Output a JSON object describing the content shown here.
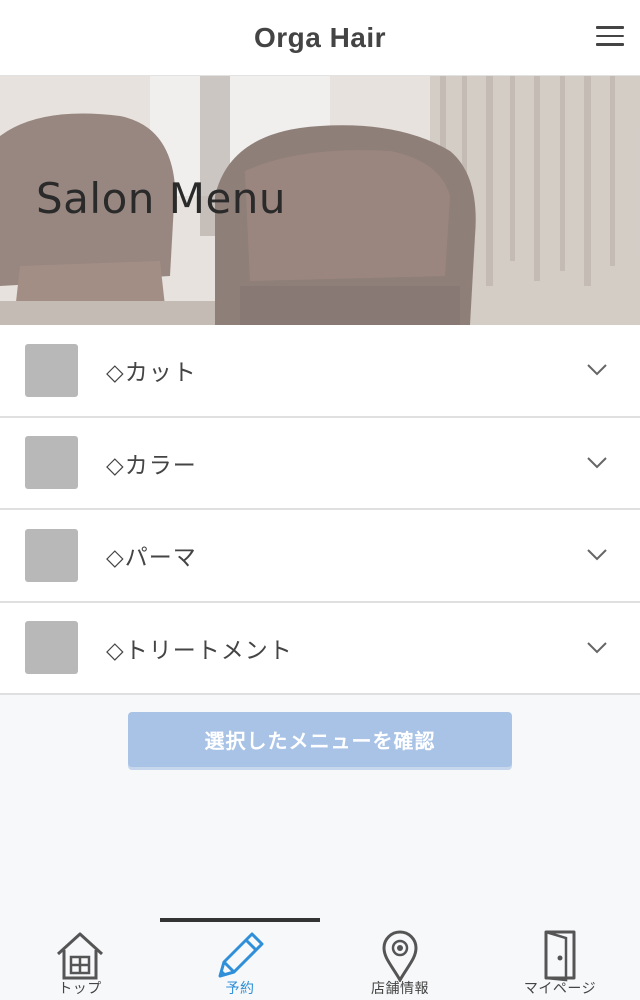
{
  "header": {
    "title": "Orga Hair",
    "menu_icon": "hamburger-icon"
  },
  "hero": {
    "title": "Salon Menu"
  },
  "menu": {
    "items": [
      {
        "label": "◇カット",
        "icon": "chevron-down-icon"
      },
      {
        "label": "◇カラー",
        "icon": "chevron-down-icon"
      },
      {
        "label": "◇パーマ",
        "icon": "chevron-down-icon"
      },
      {
        "label": "◇トリートメント",
        "icon": "chevron-down-icon"
      }
    ]
  },
  "confirm_button": {
    "label": "選択したメニューを確認"
  },
  "tabbar": {
    "tabs": [
      {
        "label": "トップ",
        "icon": "home-icon"
      },
      {
        "label": "予約",
        "icon": "pencil-icon",
        "active": true
      },
      {
        "label": "店舗情報",
        "icon": "map-pin-icon"
      },
      {
        "label": "マイページ",
        "icon": "door-icon"
      }
    ]
  },
  "colors": {
    "accent": "#2f8fd8",
    "button_bg": "#a9c3e6",
    "checkbox": "#b8b8b8"
  }
}
